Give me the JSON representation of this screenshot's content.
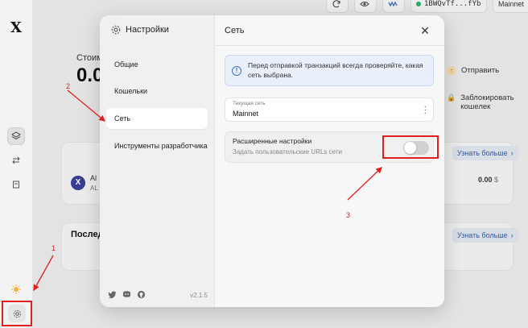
{
  "background": {
    "topbar": {
      "network_chip": "1BWQvTf...fYb",
      "network_name": "Mainnet"
    },
    "balance_label": "Стоим",
    "balance_value": "0.0",
    "actions": {
      "send": "Отправить",
      "lock": "Заблокировать кошелек"
    },
    "asset_row": {
      "name": "Al",
      "sub": "AL",
      "value": "0.00",
      "currency": "$"
    },
    "learn_more": "Узнать больше",
    "recent_title": "Последн"
  },
  "modal": {
    "title": "Настройки",
    "nav": [
      {
        "label": "Общие"
      },
      {
        "label": "Кошельки"
      },
      {
        "label": "Сеть"
      },
      {
        "label": "Инструменты разработчика"
      }
    ],
    "version": "v2.1.5",
    "header": "Сеть",
    "info_text": "Перед отправкой транзакций всегда проверяйте, какая сеть выбрана.",
    "current_network_label": "Текущая сеть",
    "current_network_value": "Mainnet",
    "advanced_title": "Расширенные настройки",
    "advanced_sub": "Задать пользовательские URLs сети",
    "advanced_enabled": false
  },
  "annotations": [
    "1",
    "2",
    "3"
  ],
  "colors": {
    "annotation": "#e02020",
    "info_bg": "#eaf0fa",
    "accent": "#3f6fbf"
  },
  "icons": [
    "gear-icon",
    "close-icon",
    "info-icon",
    "kebab-icon",
    "twitter-icon",
    "discord-icon",
    "github-icon",
    "refresh-icon",
    "eye-icon",
    "arrow-up-icon",
    "lock-icon",
    "layers-icon",
    "swap-icon",
    "book-icon",
    "sun-icon",
    "chevron-right-icon"
  ]
}
